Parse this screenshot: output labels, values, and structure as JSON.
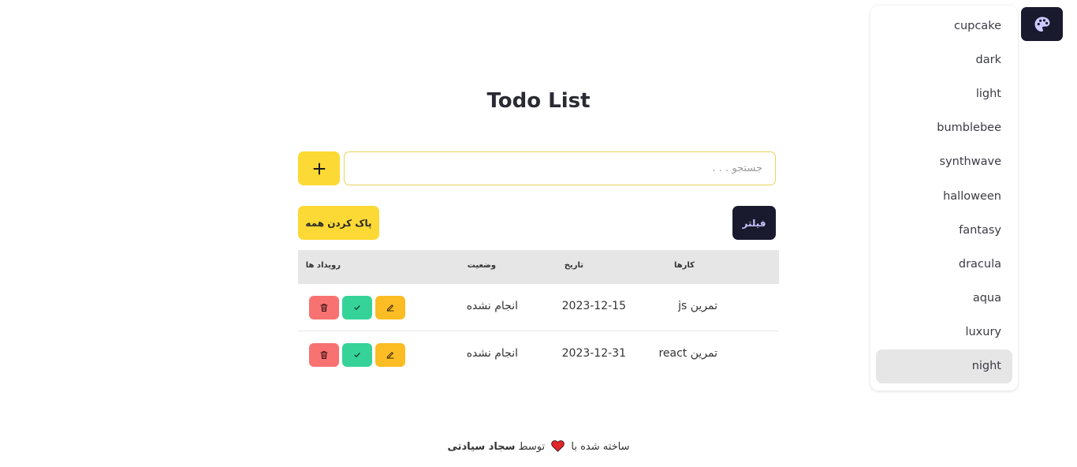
{
  "page": {
    "title": "Todo List"
  },
  "toolbar": {
    "add_label": "+",
    "search_placeholder": "جستجو . . .",
    "search_value": "",
    "clear_all_label": "پاک کردن همه",
    "filter_label": "فیلتر"
  },
  "table": {
    "headers": {
      "task": "کارها",
      "date": "تاریخ",
      "status": "وضعیت",
      "actions": "رویداد ها"
    },
    "rows": [
      {
        "task": "تمرین js",
        "date": "2023-12-15",
        "status": "انجام نشده"
      },
      {
        "task": "تمرین react",
        "date": "2023-12-31",
        "status": "انجام نشده"
      }
    ],
    "action_icons": [
      "trash-icon",
      "check-icon",
      "pencil-icon"
    ]
  },
  "theme_menu": {
    "button_icon": "palette-icon",
    "items": [
      "cupcake",
      "dark",
      "light",
      "bumblebee",
      "synthwave",
      "halloween",
      "fantasy",
      "dracula",
      "aqua",
      "luxury",
      "night"
    ],
    "active": "night"
  },
  "footer": {
    "made_with": "ساخته شده با",
    "by": "توسط",
    "author": "سجاد سیادتی"
  },
  "colors": {
    "primary": "#fcd934",
    "neutral": "#191a2e",
    "error": "#f87272",
    "success": "#36d399",
    "warning": "#fbbd23"
  }
}
